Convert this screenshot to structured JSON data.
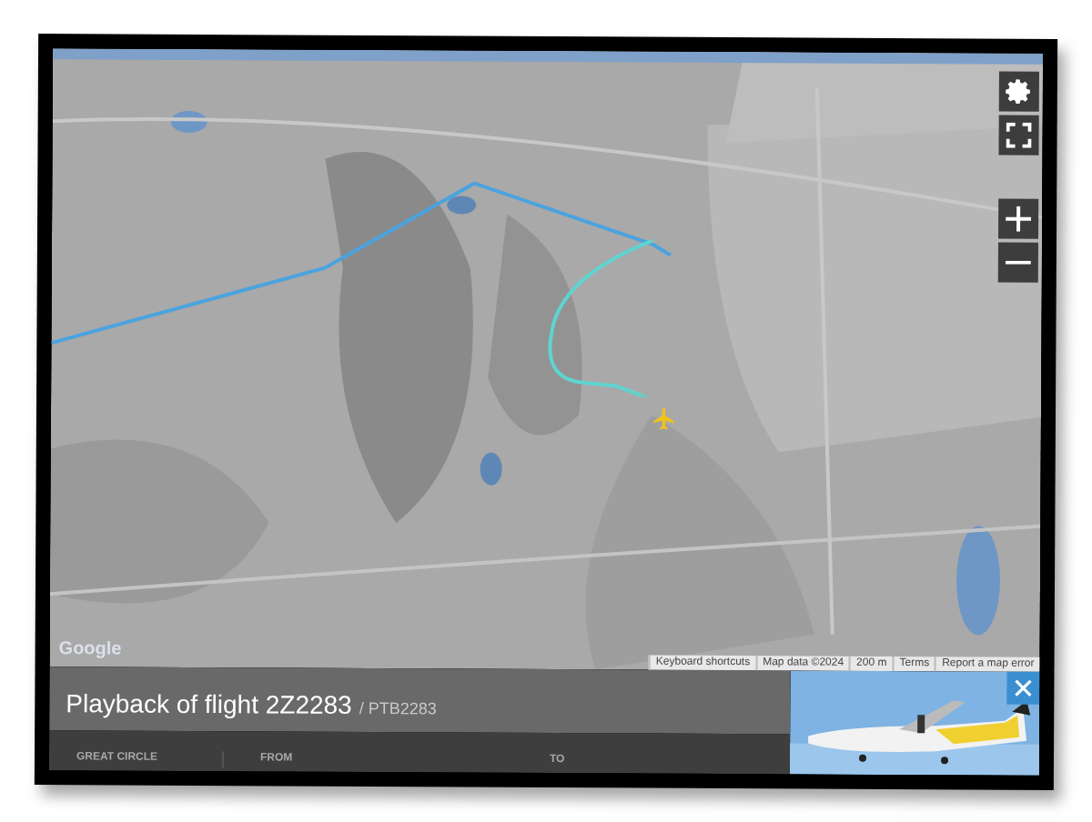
{
  "map": {
    "controls": [
      {
        "kind": "settings"
      },
      {
        "kind": "fullscreen"
      },
      {
        "kind": "zoom_in"
      },
      {
        "kind": "zoom_out"
      }
    ],
    "logo": "Google",
    "attribution": [
      "Keyboard shortcuts",
      "Map data ©2024",
      "200 m",
      "Terms",
      "Report a map error"
    ]
  },
  "panel": {
    "title": "Playback of flight 2Z2283",
    "subtitle": "/ PTB2283",
    "columns": [
      "GREAT CIRCLE",
      "FROM",
      "TO"
    ],
    "photo": {
      "kind": "picture"
    }
  }
}
